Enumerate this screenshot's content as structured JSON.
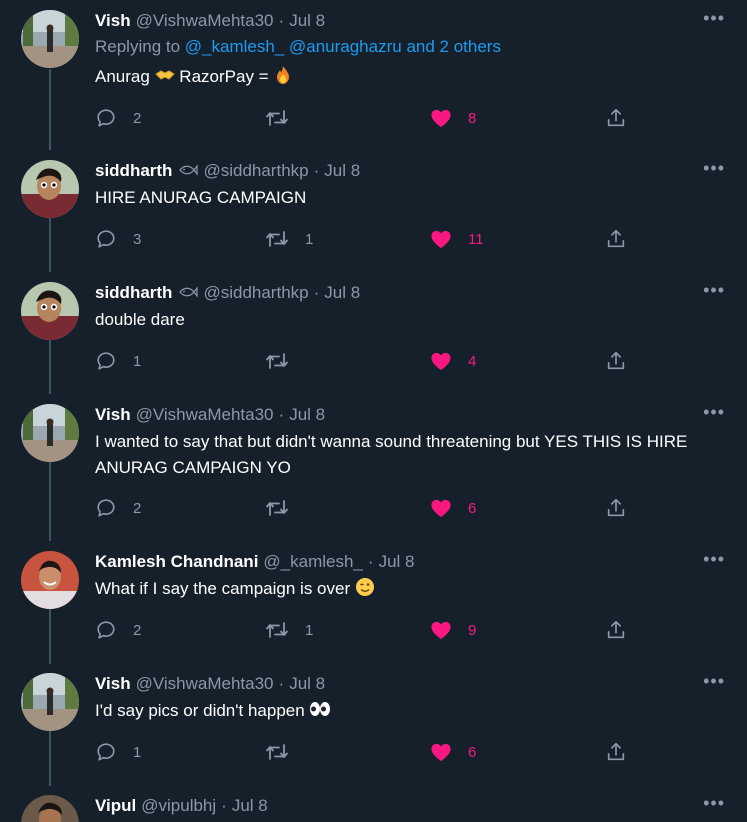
{
  "tweets": [
    {
      "name": "Vish",
      "handle": "@VishwaMehta30",
      "date": "Jul 8",
      "replying_prefix": "Replying to",
      "replying_users": "@_kamlesh_ @anuraghazru",
      "replying_others": "and 2 others",
      "text_parts": [
        "Anurag",
        "RazorPay =",
        ""
      ],
      "replies": "2",
      "retweets": "",
      "likes": "8",
      "liked": true,
      "avatar": "vish-avatar"
    },
    {
      "name": "siddharth",
      "handle": "@siddharthkp",
      "date": "Jul 8",
      "text": "HIRE ANURAG CAMPAIGN",
      "replies": "3",
      "retweets": "1",
      "likes": "11",
      "liked": true,
      "avatar": "siddharth-avatar",
      "badge": "fish-emoji-icon"
    },
    {
      "name": "siddharth",
      "handle": "@siddharthkp",
      "date": "Jul 8",
      "text": "double dare",
      "replies": "1",
      "retweets": "",
      "likes": "4",
      "liked": true,
      "avatar": "siddharth-avatar",
      "badge": "fish-emoji-icon"
    },
    {
      "name": "Vish",
      "handle": "@VishwaMehta30",
      "date": "Jul 8",
      "text": "I wanted to say that but didn't wanna sound threatening but YES THIS IS HIRE ANURAG CAMPAIGN YO",
      "replies": "2",
      "retweets": "",
      "likes": "6",
      "liked": true,
      "avatar": "vish-avatar"
    },
    {
      "name": "Kamlesh Chandnani",
      "handle": "@_kamlesh_",
      "date": "Jul 8",
      "text": "What if I say the campaign is over",
      "replies": "2",
      "retweets": "1",
      "likes": "9",
      "liked": true,
      "avatar": "kamlesh-avatar"
    },
    {
      "name": "Vish",
      "handle": "@VishwaMehta30",
      "date": "Jul 8",
      "text": "I'd say pics or didn't happen",
      "replies": "1",
      "retweets": "",
      "likes": "6",
      "liked": true,
      "avatar": "vish-avatar"
    },
    {
      "name": "Vipul",
      "handle": "@vipulbhj",
      "date": "Jul 8",
      "avatar": "vipul-avatar"
    }
  ],
  "more_label": "•••",
  "dot": "·",
  "colors": {
    "background": "#15202b",
    "secondary_text": "#8b98a5",
    "link": "#1d9bf0",
    "like": "#f91880",
    "thread_line": "#3d5466"
  }
}
